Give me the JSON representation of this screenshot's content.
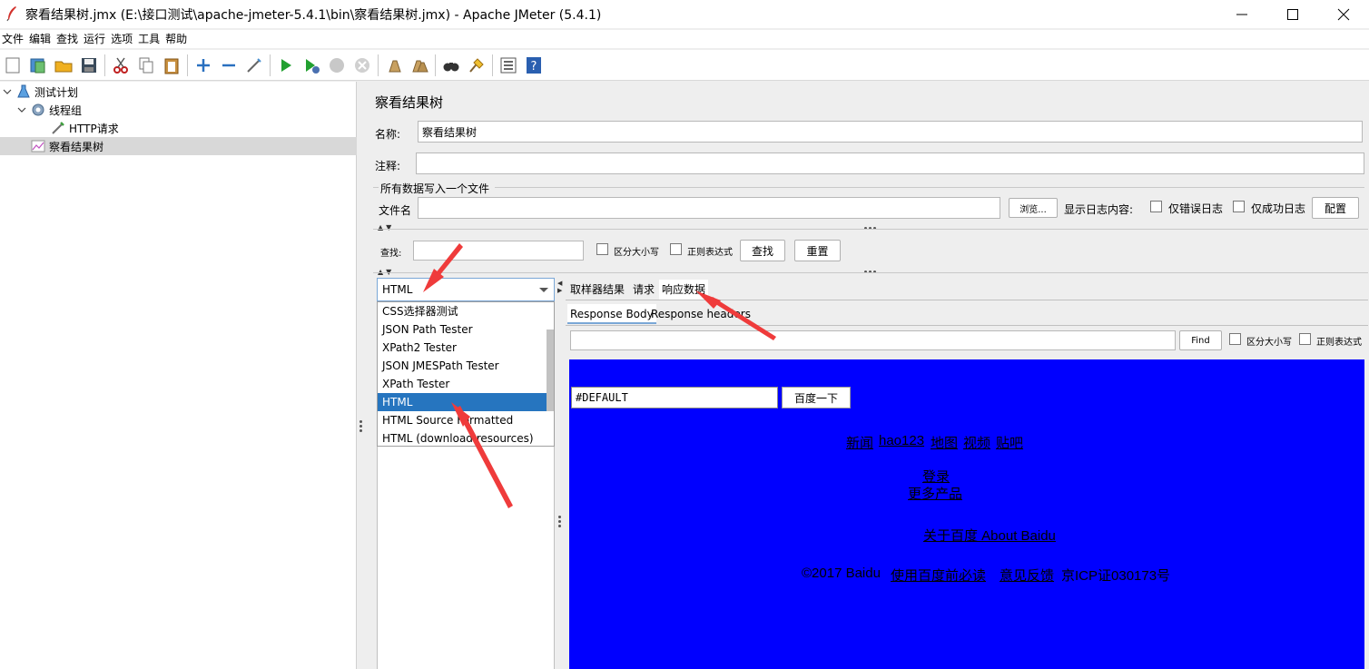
{
  "window": {
    "title": "察看结果树.jmx (E:\\接口测试\\apache-jmeter-5.4.1\\bin\\察看结果树.jmx) - Apache JMeter (5.4.1)"
  },
  "menu": [
    "文件",
    "编辑",
    "查找",
    "运行",
    "选项",
    "工具",
    "帮助"
  ],
  "tree": {
    "items": [
      {
        "label": "测试计划"
      },
      {
        "label": "线程组"
      },
      {
        "label": "HTTP请求"
      },
      {
        "label": "察看结果树"
      }
    ]
  },
  "panel": {
    "title": "察看结果树",
    "name_label": "名称:",
    "name_value": "察看结果树",
    "comment_label": "注释:",
    "comment_value": "",
    "file_group_label": "所有数据写入一个文件",
    "filename_label": "文件名",
    "filename_value": "",
    "browse_label": "浏览...",
    "log_label": "显示日志内容:",
    "errors_only_label": "仅错误日志",
    "success_only_label": "仅成功日志",
    "configure_label": "配置"
  },
  "search": {
    "label": "查找:",
    "value": "",
    "case_label": "区分大小写",
    "regex_label": "正则表达式",
    "find_label": "查找",
    "reset_label": "重置"
  },
  "renderer": {
    "selected": "HTML",
    "options": [
      "CSS选择器测试",
      "JSON Path Tester",
      "XPath2 Tester",
      "JSON JMESPath Tester",
      "XPath Tester",
      "HTML",
      "HTML Source Formatted",
      "HTML (download resources)"
    ],
    "selected_index": 5
  },
  "tabs": {
    "main": [
      "取样器结果",
      "请求",
      "响应数据"
    ],
    "active_main": 2,
    "sub": [
      "Response Body",
      "Response headers"
    ],
    "active_sub": 0
  },
  "response_search": {
    "value": "",
    "find_label": "Find",
    "case_label": "区分大小写",
    "regex_label": "正则表达式"
  },
  "rendered_page": {
    "background": "#0000ff",
    "input_value": "#DEFAULT",
    "submit_label": "百度一下",
    "nav_links": [
      "新闻",
      "hao123",
      "地图",
      "视频",
      "贴吧"
    ],
    "login_link": "登录",
    "more_link": "更多产品",
    "about_link": "关于百度 About Baidu",
    "copyright": "©2017 Baidu",
    "must_read_link": "使用百度前必读",
    "feedback_link": "意见反馈",
    "icp": "京ICP证030173号"
  },
  "colors": {
    "selection": "#2675bf",
    "annotation_arrow": "#ef3b3b"
  }
}
